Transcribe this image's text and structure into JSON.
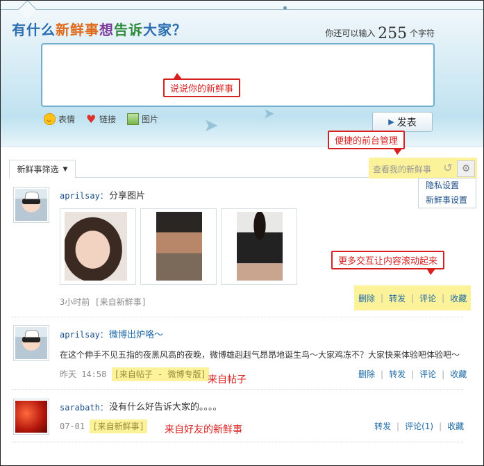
{
  "header": {
    "title_parts": [
      "有什么",
      "新鲜事",
      "想",
      "告诉",
      "大家",
      "？"
    ],
    "counter_prefix": "你还可以输入",
    "counter_value": "255",
    "counter_suffix": "个字符"
  },
  "composer": {
    "placeholder": "",
    "tools": [
      {
        "icon": "smile-icon",
        "label": "表情"
      },
      {
        "icon": "heart-icon",
        "label": "链接"
      },
      {
        "icon": "picture-icon",
        "label": "图片"
      }
    ],
    "post_button": "发表"
  },
  "annotations": {
    "callout_composer": "说说你的新鲜事",
    "callout_manage": "便捷的前台管理",
    "callout_scroll": "更多交互让内容滚动起来",
    "label_from_post": "来自帖子",
    "label_from_friend": "来自好友的新鲜事"
  },
  "filter": {
    "tab_label": "新鲜事筛选",
    "view_mine": "查看我的新鲜事",
    "menu": [
      "隐私设置",
      "新鲜事设置"
    ]
  },
  "feed": [
    {
      "author": "aprilsay",
      "message": "分享图片",
      "images": [
        "photo-woman-portrait",
        "photo-man-portrait",
        "photo-woman-standing"
      ],
      "time": "3小时前",
      "source": "[来自新鲜事]",
      "actions": [
        "删除",
        "转发",
        "评论",
        "收藏"
      ]
    },
    {
      "author": "aprilsay",
      "message": "微博出炉咯～",
      "body": "在这个伸手不见五指的夜黑风高的夜晚，微博雄赳赳气昂昂地诞生鸟～大家鸡冻不？大家快来体验吧体验吧～",
      "time": "昨天 14:58",
      "source": "[来自帖子 - 微博专版]",
      "actions": [
        "删除",
        "转发",
        "评论",
        "收藏"
      ]
    },
    {
      "author": "sarabath",
      "message": "没有什么好告诉大家的。。。。",
      "time": "07-01",
      "source": "[来自新鲜事]",
      "actions": [
        "转发",
        "评论(1)",
        "收藏"
      ]
    }
  ],
  "colors": {
    "link": "#1d6aa8",
    "highlight": "#fbf29a",
    "annotation": "#d82020"
  }
}
